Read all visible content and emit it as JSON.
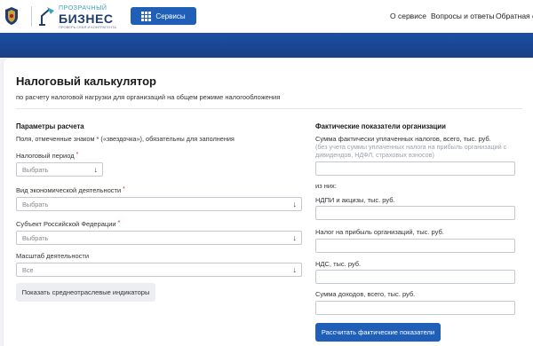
{
  "header": {
    "logo": {
      "top": "ПРОЗРАЧНЫЙ",
      "main": "БИЗНЕС",
      "sub": "ПРОВЕРЬ СЕБЯ И КОНТРАГЕНТА"
    },
    "services_label": "Сервисы",
    "nav": [
      "О сервисе",
      "Вопросы и ответы",
      "Обратная св"
    ]
  },
  "page": {
    "title": "Налоговый калькулятор",
    "subtitle": "по расчету налоговой нагрузки для организаций на общем режиме налогообложения"
  },
  "left": {
    "heading": "Параметры расчета",
    "note": "Поля, отмеченные знаком * («звездочка»), обязательны для заполнения",
    "required_mark": "*",
    "fields": [
      {
        "label": "Налоговый период",
        "value": "Выбрать"
      },
      {
        "label": "Вид экономической деятельности",
        "value": "Выбрать"
      },
      {
        "label": "Субъект Российской Федерации",
        "value": "Выбрать"
      },
      {
        "label": "Масштаб деятельности",
        "value": "Все"
      }
    ],
    "button": "Показать среднеотраслевые индикаторы"
  },
  "right": {
    "heading": "Фактические показатели организации",
    "sum_label": "Сумма фактически уплаченных налогов, всего, тыс. руб.",
    "sum_hint": "(без учета суммы уплаченных налога на прибыль организаций с дивидендов, НДФЛ, страховых взносов)",
    "of_which": "из них:",
    "ndpi_label": "НДПИ и акцизы, тыс. руб.",
    "profit_label": "Налог на прибыль организаций, тыс. руб.",
    "vat_label": "НДС, тыс. руб.",
    "income_label": "Сумма доходов, всего, тыс. руб.",
    "button": "Рассчитать фактические показатели"
  },
  "colors": {
    "accent": "#1f5fb8",
    "banner": "#1b4fa4",
    "required": "#d32f2f"
  }
}
